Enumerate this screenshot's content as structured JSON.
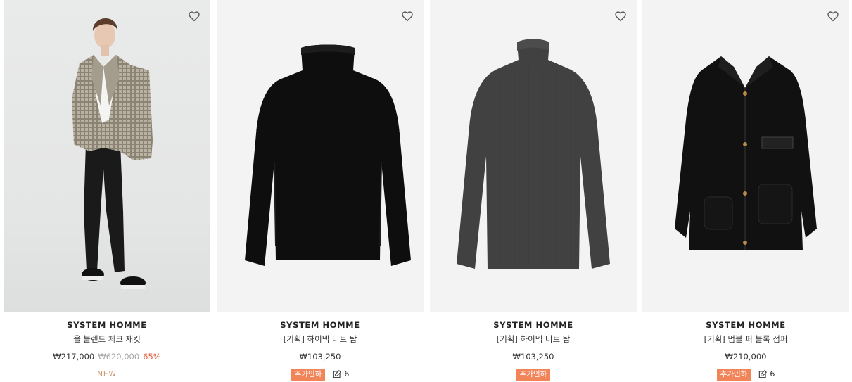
{
  "products": [
    {
      "brand": "SYSTEM HOMME",
      "name": "울 블렌드 체크 재킷",
      "price": "₩217,000",
      "original_price": "₩620,000",
      "discount": "65%",
      "badge": "NEW",
      "image": "model-check-jacket"
    },
    {
      "brand": "SYSTEM HOMME",
      "name": "[기획] 하이넥 니트 탑",
      "price": "₩103,250",
      "coupon": "추가인하",
      "review_count": "6",
      "image": "black-turtleneck-knit"
    },
    {
      "brand": "SYSTEM HOMME",
      "name": "[기획] 하이넥 니트 탑",
      "price": "₩103,250",
      "coupon": "추가인하",
      "image": "charcoal-turtleneck-knit"
    },
    {
      "brand": "SYSTEM HOMME",
      "name": "[기획] 멈블 퍼 블록 점퍼",
      "price": "₩210,000",
      "coupon": "추가인하",
      "review_count": "6",
      "image": "black-fleece-jumper"
    }
  ],
  "icons": {
    "wishlist": "heart-outline-icon",
    "review": "edit-icon"
  },
  "colors": {
    "discount": "#e2603f",
    "coupon_bg": "#f2845a",
    "new_badge": "#c8966e"
  }
}
